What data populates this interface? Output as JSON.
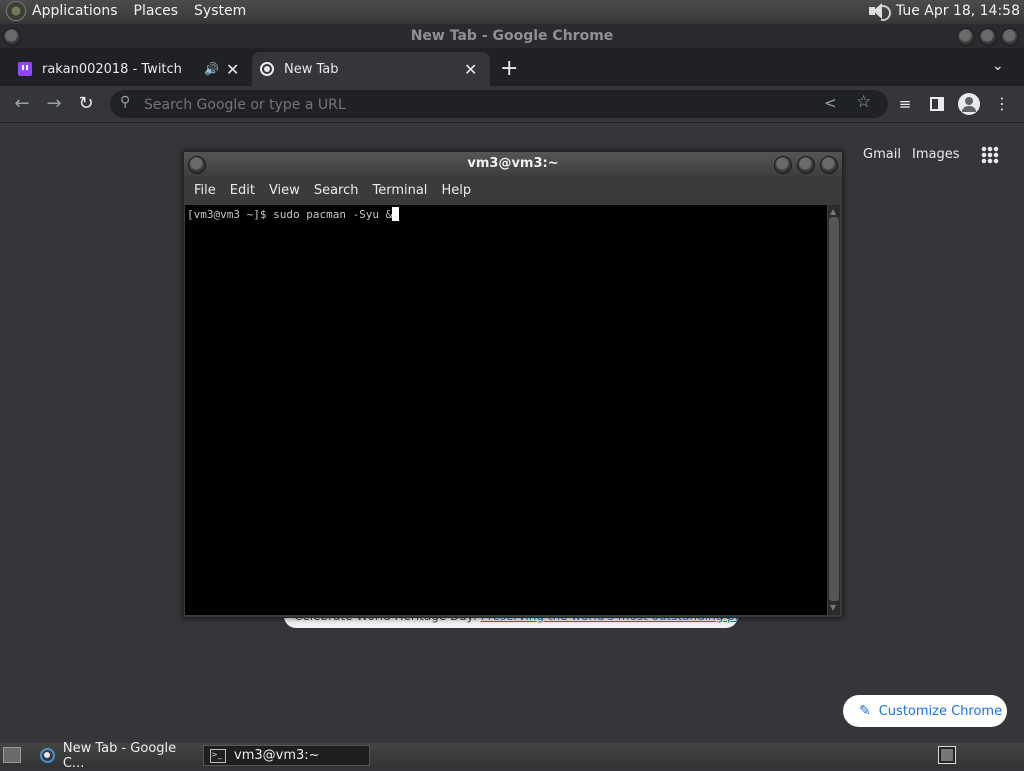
{
  "top_panel": {
    "menus": [
      "Applications",
      "Places",
      "System"
    ],
    "clock": "Tue Apr 18, 14:58"
  },
  "chrome": {
    "window_title": "New Tab - Google Chrome",
    "tabs": [
      {
        "label": "rakan002018 - Twitch",
        "icon": "twitch-icon",
        "audio": true
      },
      {
        "label": "New Tab",
        "icon": "chrome-icon",
        "active": true
      }
    ],
    "omnibox_placeholder": "Search Google or type a URL",
    "ntp_links": [
      "Gmail",
      "Images"
    ],
    "promo": {
      "text": "Celebrate World Heritage Day: ",
      "link": "Preserving the world's most outstanding places"
    },
    "customize_label": "Customize Chrome"
  },
  "terminal": {
    "title": "vm3@vm3:~",
    "menu": [
      "File",
      "Edit",
      "View",
      "Search",
      "Terminal",
      "Help"
    ],
    "prompt": "[vm3@vm3 ~]$ ",
    "command": "sudo pacman -Syu &"
  },
  "taskbar": {
    "items": [
      {
        "label": "New Tab - Google C...",
        "icon": "chrome-icon"
      },
      {
        "label": "vm3@vm3:~",
        "icon": "terminal-icon",
        "active": true
      }
    ]
  }
}
